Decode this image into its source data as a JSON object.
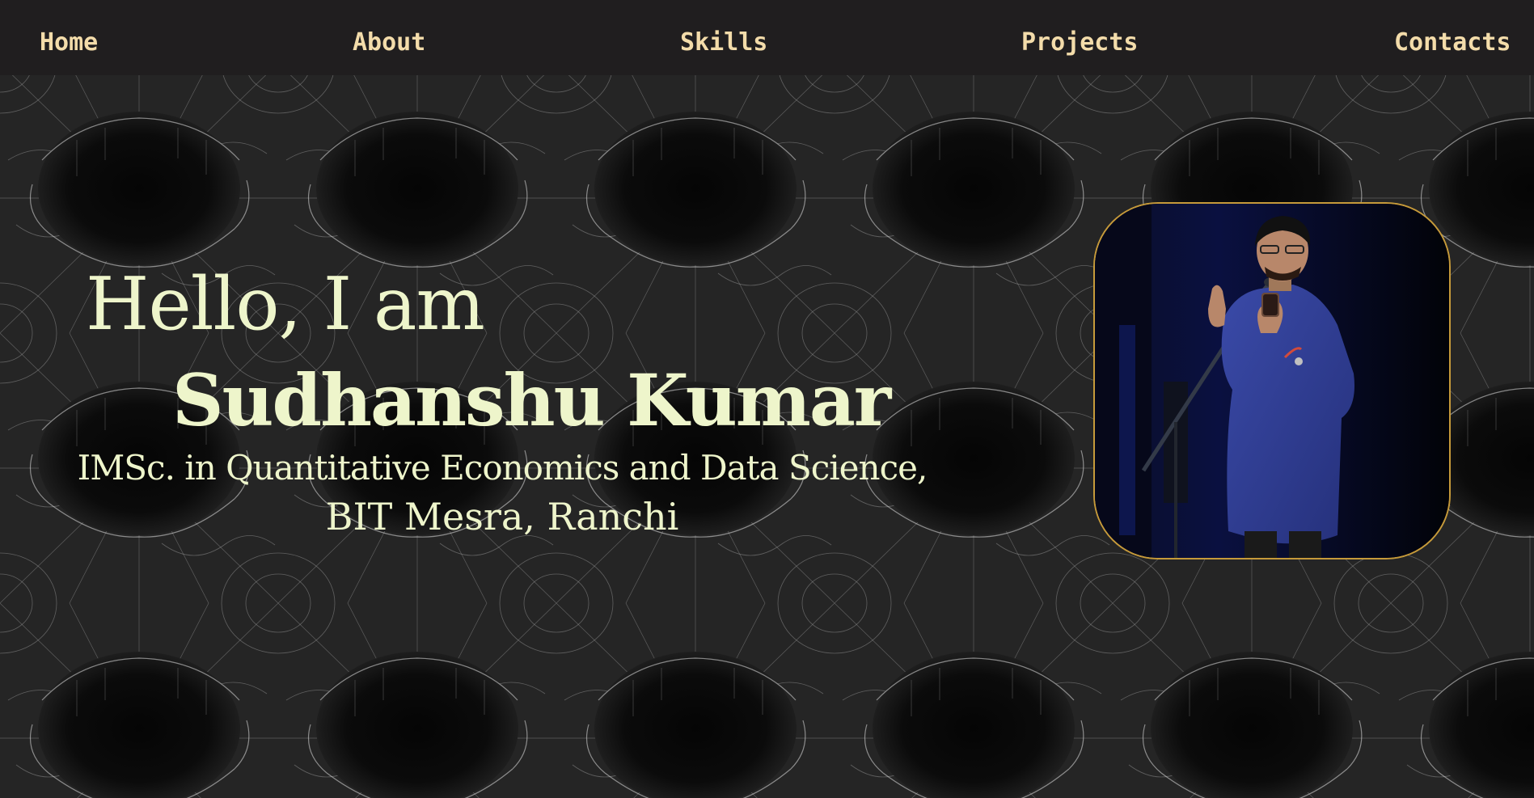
{
  "nav": {
    "home": "Home",
    "about": "About",
    "skills": "Skills",
    "projects": "Projects",
    "contacts": "Contacts"
  },
  "hero": {
    "greeting": "Hello, I am",
    "name": "Sudhanshu Kumar",
    "degree": "IMSc. in Quantitative Economics and Data Science,",
    "institute": "BIT Mesra, Ranchi"
  },
  "theme": {
    "nav_background": "#201e1f",
    "nav_text": "#f3dcaa",
    "hero_text": "#eef5cb",
    "photo_border": "#c69a3a",
    "background": "#0c0c0c"
  },
  "icons": {
    "background": "spider-web-pattern",
    "photo": "speaker-at-microphone"
  }
}
